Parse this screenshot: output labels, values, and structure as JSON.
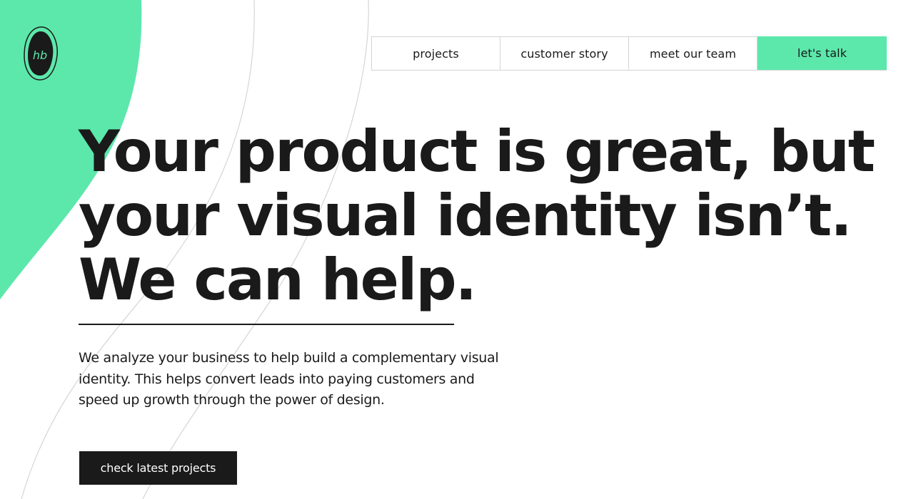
{
  "brand": {
    "logo_text": "hb",
    "accent_color": "#5ce8ab",
    "dark_color": "#1a1a1a"
  },
  "nav": {
    "items": [
      {
        "label": "projects"
      },
      {
        "label": "customer story"
      },
      {
        "label": "meet our team"
      },
      {
        "label": "let's talk"
      }
    ]
  },
  "hero": {
    "headline_lines": [
      "Your product is great, but",
      "your visual identity isn’t.",
      "We can help."
    ],
    "lead": "We analyze your business to help build a complementary visual identity. This helps convert leads into paying customers and speed up growth through the power of design.",
    "cta_label": "check latest projects"
  }
}
